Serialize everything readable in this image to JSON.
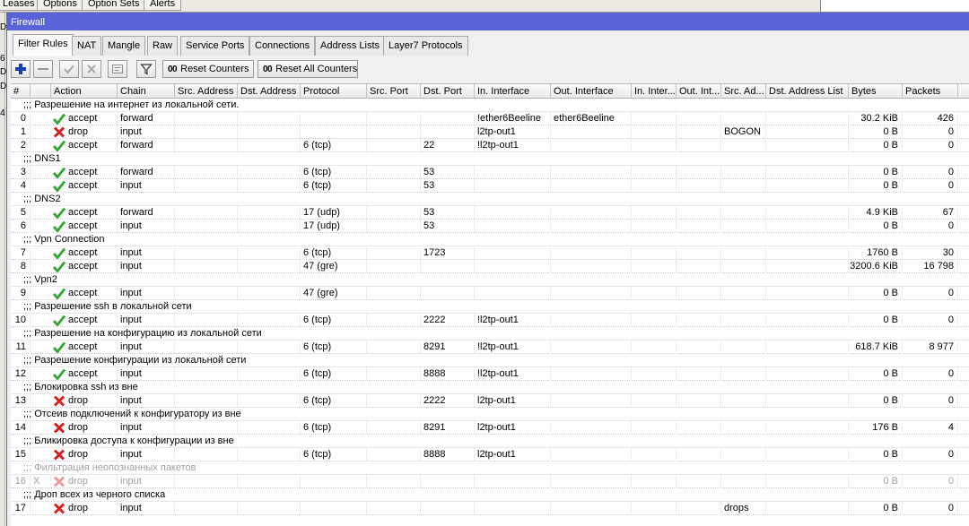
{
  "background": {
    "tabs": [
      "Leases",
      "Options",
      "Option Sets",
      "Alerts"
    ],
    "left_letters": [
      "D",
      "6",
      "D",
      "D",
      "4"
    ]
  },
  "window": {
    "title": "Firewall"
  },
  "tabs": [
    {
      "label": "Filter Rules",
      "active": true
    },
    {
      "label": "NAT"
    },
    {
      "label": "Mangle"
    },
    {
      "label": "Raw"
    },
    {
      "label": "Service Ports"
    },
    {
      "label": "Connections"
    },
    {
      "label": "Address Lists"
    },
    {
      "label": "Layer7 Protocols"
    }
  ],
  "toolbar": {
    "add_icon": "plus-icon",
    "remove_icon": "minus-icon",
    "enable_icon": "check-icon",
    "disable_icon": "cross-icon",
    "comment_icon": "note-icon",
    "filter_icon": "filter-icon",
    "counter_prefix": "00",
    "reset_counters": "Reset Counters",
    "reset_all_counters": "Reset All Counters"
  },
  "columns": [
    "#",
    "Action",
    "Chain",
    "Src. Address",
    "Dst. Address",
    "Protocol",
    "Src. Port",
    "Dst. Port",
    "In. Interface",
    "Out. Interface",
    "In. Inter...",
    "Out. Int...",
    "Src. Ad...",
    "Dst. Address List",
    "Bytes",
    "Packets"
  ],
  "colors": {
    "accept": "#3aa53a",
    "drop": "#d42020",
    "title_bar": "#5a63d6"
  },
  "rows": [
    {
      "type": "comment",
      "text": ";;; Разрешение на интернет из локальной сети."
    },
    {
      "type": "rule",
      "num": "0",
      "action": "accept",
      "chain": "forward",
      "protocol": "",
      "dst_port": "",
      "in_iface": "!ether6Beeline",
      "out_iface": "ether6Beeline",
      "src_list": "",
      "bytes": "30.2 KiB",
      "packets": "426"
    },
    {
      "type": "rule",
      "num": "1",
      "action": "drop",
      "chain": "input",
      "protocol": "",
      "dst_port": "",
      "in_iface": "l2tp-out1",
      "out_iface": "",
      "src_list": "BOGON",
      "bytes": "0 B",
      "packets": "0"
    },
    {
      "type": "rule",
      "num": "2",
      "action": "accept",
      "chain": "forward",
      "protocol": "6 (tcp)",
      "dst_port": "22",
      "in_iface": "!l2tp-out1",
      "out_iface": "",
      "src_list": "",
      "bytes": "0 B",
      "packets": "0"
    },
    {
      "type": "comment",
      "text": ";;; DNS1"
    },
    {
      "type": "rule",
      "num": "3",
      "action": "accept",
      "chain": "forward",
      "protocol": "6 (tcp)",
      "dst_port": "53",
      "in_iface": "",
      "out_iface": "",
      "src_list": "",
      "bytes": "0 B",
      "packets": "0"
    },
    {
      "type": "rule",
      "num": "4",
      "action": "accept",
      "chain": "input",
      "protocol": "6 (tcp)",
      "dst_port": "53",
      "in_iface": "",
      "out_iface": "",
      "src_list": "",
      "bytes": "0 B",
      "packets": "0"
    },
    {
      "type": "comment",
      "text": ";;; DNS2"
    },
    {
      "type": "rule",
      "num": "5",
      "action": "accept",
      "chain": "forward",
      "protocol": "17 (udp)",
      "dst_port": "53",
      "in_iface": "",
      "out_iface": "",
      "src_list": "",
      "bytes": "4.9 KiB",
      "packets": "67"
    },
    {
      "type": "rule",
      "num": "6",
      "action": "accept",
      "chain": "input",
      "protocol": "17 (udp)",
      "dst_port": "53",
      "in_iface": "",
      "out_iface": "",
      "src_list": "",
      "bytes": "0 B",
      "packets": "0"
    },
    {
      "type": "comment",
      "text": ";;; Vpn Connection"
    },
    {
      "type": "rule",
      "num": "7",
      "action": "accept",
      "chain": "input",
      "protocol": "6 (tcp)",
      "dst_port": "1723",
      "in_iface": "",
      "out_iface": "",
      "src_list": "",
      "bytes": "1760 B",
      "packets": "30"
    },
    {
      "type": "rule",
      "num": "8",
      "action": "accept",
      "chain": "input",
      "protocol": "47 (gre)",
      "dst_port": "",
      "in_iface": "",
      "out_iface": "",
      "src_list": "",
      "bytes": "3200.6 KiB",
      "packets": "16 798"
    },
    {
      "type": "comment",
      "text": ";;; Vpn2"
    },
    {
      "type": "rule",
      "num": "9",
      "action": "accept",
      "chain": "input",
      "protocol": "47 (gre)",
      "dst_port": "",
      "in_iface": "",
      "out_iface": "",
      "src_list": "",
      "bytes": "0 B",
      "packets": "0"
    },
    {
      "type": "comment",
      "text": ";;; Разрешение ssh  в локальной сети"
    },
    {
      "type": "rule",
      "num": "10",
      "action": "accept",
      "chain": "input",
      "protocol": "6 (tcp)",
      "dst_port": "2222",
      "in_iface": "!l2tp-out1",
      "out_iface": "",
      "src_list": "",
      "bytes": "0 B",
      "packets": "0"
    },
    {
      "type": "comment",
      "text": ";;; Разрешение на конфигурацию из локальной сети"
    },
    {
      "type": "rule",
      "num": "11",
      "action": "accept",
      "chain": "input",
      "protocol": "6 (tcp)",
      "dst_port": "8291",
      "in_iface": "!l2tp-out1",
      "out_iface": "",
      "src_list": "",
      "bytes": "618.7 KiB",
      "packets": "8 977"
    },
    {
      "type": "comment",
      "text": ";;; Разрешение конфигурации из локальной сети"
    },
    {
      "type": "rule",
      "num": "12",
      "action": "accept",
      "chain": "input",
      "protocol": "6 (tcp)",
      "dst_port": "8888",
      "in_iface": "!l2tp-out1",
      "out_iface": "",
      "src_list": "",
      "bytes": "0 B",
      "packets": "0"
    },
    {
      "type": "comment",
      "text": ";;; Блокировка ssh из вне"
    },
    {
      "type": "rule",
      "num": "13",
      "action": "drop",
      "chain": "input",
      "protocol": "6 (tcp)",
      "dst_port": "2222",
      "in_iface": "l2tp-out1",
      "out_iface": "",
      "src_list": "",
      "bytes": "0 B",
      "packets": "0"
    },
    {
      "type": "comment",
      "text": ";;; Отсеив подключений к конфигуратору из вне"
    },
    {
      "type": "rule",
      "num": "14",
      "action": "drop",
      "chain": "input",
      "protocol": "6 (tcp)",
      "dst_port": "8291",
      "in_iface": "l2tp-out1",
      "out_iface": "",
      "src_list": "",
      "bytes": "176 B",
      "packets": "4"
    },
    {
      "type": "comment",
      "text": ";;; Бликировка доступа к конфигурации из вне"
    },
    {
      "type": "rule",
      "num": "15",
      "action": "drop",
      "chain": "input",
      "protocol": "6 (tcp)",
      "dst_port": "8888",
      "in_iface": "l2tp-out1",
      "out_iface": "",
      "src_list": "",
      "bytes": "0 B",
      "packets": "0"
    },
    {
      "type": "comment",
      "text": ";;; Фильтрация неопознанных пакетов",
      "disabled": true
    },
    {
      "type": "rule",
      "num": "16",
      "flag": "X",
      "disabled": true,
      "action": "drop",
      "chain": "input",
      "protocol": "",
      "dst_port": "",
      "in_iface": "",
      "out_iface": "",
      "src_list": "",
      "bytes": "0 B",
      "packets": "0"
    },
    {
      "type": "comment",
      "text": ";;; Дроп всех из черного списка"
    },
    {
      "type": "rule",
      "num": "17",
      "action": "drop",
      "chain": "input",
      "protocol": "",
      "dst_port": "",
      "in_iface": "",
      "out_iface": "",
      "src_list": "drops",
      "bytes": "0 B",
      "packets": "0"
    }
  ]
}
